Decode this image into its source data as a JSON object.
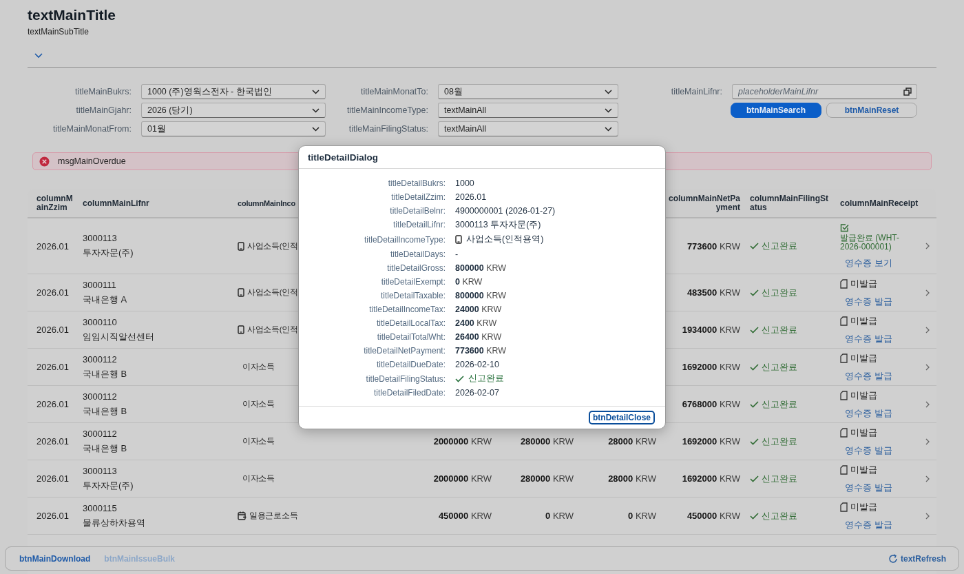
{
  "header": {
    "title": "textMainTitle",
    "subtitle": "textMainSubTitle",
    "expanded": false
  },
  "filter_columns": [
    [
      {
        "kind": "select",
        "label": "titleMainBukrs:",
        "value": "1000 (주)영웍스전자 - 한국법인"
      },
      {
        "kind": "select",
        "label": "titleMainGjahr:",
        "value": "2026 (당기)"
      },
      {
        "kind": "select",
        "label": "titleMainMonatFrom:",
        "value": "01월"
      }
    ],
    [
      {
        "kind": "select",
        "label": "titleMainMonatTo:",
        "value": "08월"
      },
      {
        "kind": "select",
        "label": "titleMainIncomeType:",
        "value": "textMainAll"
      },
      {
        "kind": "select",
        "label": "titleMainFilingStatus:",
        "value": "textMainAll"
      }
    ],
    [
      {
        "kind": "input",
        "label": "titleMainLifnr:",
        "placeholder": "placeholderMainLifnr"
      }
    ]
  ],
  "filter_buttons": [
    {
      "label": "btnMainSearch",
      "kind": "primary"
    },
    {
      "label": "btnMainReset",
      "kind": "secondary"
    }
  ],
  "message": {
    "text": "msgMainOverdue"
  },
  "table": {
    "columns": {
      "zzim": "columnMainZzim",
      "lifnr": "columnMainLifnr",
      "income_type": "columnMainInco",
      "net_payment": "columnMainNetPayment",
      "filing_status": "columnMainFilingStatus",
      "receipt": "columnMainReceipt"
    },
    "rows": [
      {
        "zzim": "2026.01",
        "lifnr": "3000113",
        "name": "투자자문(주)",
        "income": {
          "kind": "business",
          "text": "사업소득(인적"
        },
        "net": {
          "value": "773600",
          "unit": "KRW"
        },
        "filing": {
          "text": "신고완료"
        },
        "receipt": {
          "issued": true,
          "text": "발급완료 (WHT-2026-000001)",
          "link": "영수증 보기"
        }
      },
      {
        "zzim": "2026.01",
        "lifnr": "3000111",
        "name": "국내은행 A",
        "income": {
          "kind": "business",
          "text": "사업소득(인적"
        },
        "net": {
          "value": "483500",
          "unit": "KRW"
        },
        "filing": {
          "text": "신고완료"
        },
        "receipt": {
          "issued": false,
          "text": "미발급",
          "link": "영수증 발급"
        }
      },
      {
        "zzim": "2026.01",
        "lifnr": "3000110",
        "name": "임임시직알선센터",
        "income": {
          "kind": "business",
          "text": "사업소득(인적"
        },
        "net": {
          "value": "1934000",
          "unit": "KRW"
        },
        "filing": {
          "text": "신고완료"
        },
        "receipt": {
          "issued": false,
          "text": "미발급",
          "link": "영수증 발급"
        }
      },
      {
        "zzim": "2026.01",
        "lifnr": "3000112",
        "name": "국내은행 B",
        "income": {
          "kind": "interest",
          "text": "이자소득"
        },
        "net": {
          "value": "1692000",
          "unit": "KRW"
        },
        "filing": {
          "text": "신고완료"
        },
        "receipt": {
          "issued": false,
          "text": "미발급",
          "link": "영수증 발급"
        }
      },
      {
        "zzim": "2026.01",
        "lifnr": "3000112",
        "name": "국내은행 B",
        "income": {
          "kind": "interest",
          "text": "이자소득"
        },
        "net": {
          "value": "6768000",
          "unit": "KRW"
        },
        "filing": {
          "text": "신고완료"
        },
        "receipt": {
          "issued": false,
          "text": "미발급",
          "link": "영수증 발급"
        }
      },
      {
        "zzim": "2026.01",
        "lifnr": "3000112",
        "name": "국내은행 B",
        "income": {
          "kind": "interest",
          "text": "이자소득"
        },
        "amounts": [
          {
            "value": "2000000",
            "unit": "KRW"
          },
          {
            "value": "280000",
            "unit": "KRW"
          },
          {
            "value": "28000",
            "unit": "KRW"
          }
        ],
        "net": {
          "value": "1692000",
          "unit": "KRW"
        },
        "filing": {
          "text": "신고완료"
        },
        "receipt": {
          "issued": false,
          "text": "미발급",
          "link": "영수증 발급"
        }
      },
      {
        "zzim": "2026.01",
        "lifnr": "3000113",
        "name": "투자자문(주)",
        "income": {
          "kind": "interest",
          "text": "이자소득"
        },
        "amounts": [
          {
            "value": "2000000",
            "unit": "KRW"
          },
          {
            "value": "280000",
            "unit": "KRW"
          },
          {
            "value": "28000",
            "unit": "KRW"
          }
        ],
        "net": {
          "value": "1692000",
          "unit": "KRW"
        },
        "filing": {
          "text": "신고완료"
        },
        "receipt": {
          "issued": false,
          "text": "미발급",
          "link": "영수증 발급"
        }
      },
      {
        "zzim": "2026.01",
        "lifnr": "3000115",
        "name": "물류상하차용역",
        "income": {
          "kind": "daily",
          "text": "일용근로소득"
        },
        "amounts": [
          {
            "value": "450000",
            "unit": "KRW"
          },
          {
            "value": "0",
            "unit": "KRW"
          },
          {
            "value": "0",
            "unit": "KRW"
          }
        ],
        "net": {
          "value": "450000",
          "unit": "KRW"
        },
        "filing": {
          "text": "신고완료"
        },
        "receipt": {
          "issued": false,
          "text": "미발급",
          "link": "영수증 발급"
        }
      }
    ]
  },
  "dialog": {
    "title": "titleDetailDialog",
    "fields": [
      {
        "kind": "text",
        "label": "titleDetailBukrs:",
        "value": "1000"
      },
      {
        "kind": "text",
        "label": "titleDetailZzim:",
        "value": "2026.01"
      },
      {
        "kind": "text",
        "label": "titleDetailBelnr:",
        "value": "4900000001 (2026-01-27)"
      },
      {
        "kind": "text",
        "label": "titleDetailLifnr:",
        "value": "3000113 투자자문(주)"
      },
      {
        "kind": "income",
        "label": "titleDetailIncomeType:",
        "value": "사업소득(인적용역)"
      },
      {
        "kind": "text",
        "label": "titleDetailDays:",
        "value": "-"
      },
      {
        "kind": "amount",
        "label": "titleDetailGross:",
        "value": "800000",
        "unit": "KRW"
      },
      {
        "kind": "amount",
        "label": "titleDetailExempt:",
        "value": "0",
        "unit": "KRW"
      },
      {
        "kind": "amount",
        "label": "titleDetailTaxable:",
        "value": "800000",
        "unit": "KRW"
      },
      {
        "kind": "amount",
        "label": "titleDetailIncomeTax:",
        "value": "24000",
        "unit": "KRW"
      },
      {
        "kind": "amount",
        "label": "titleDetailLocalTax:",
        "value": "2400",
        "unit": "KRW"
      },
      {
        "kind": "amount",
        "label": "titleDetailTotalWht:",
        "value": "26400",
        "unit": "KRW"
      },
      {
        "kind": "amount",
        "label": "titleDetailNetPayment:",
        "value": "773600",
        "unit": "KRW"
      },
      {
        "kind": "text",
        "label": "titleDetailDueDate:",
        "value": "2026-02-10"
      },
      {
        "kind": "status",
        "label": "titleDetailFilingStatus:",
        "value": "신고완료"
      },
      {
        "kind": "text",
        "label": "titleDetailFiledDate:",
        "value": "2026-02-07"
      }
    ],
    "close_button": "btnDetailClose"
  },
  "footer": {
    "buttons": [
      {
        "label": "btnMainDownload",
        "disabled": false
      },
      {
        "label": "btnMainIssueBulk",
        "disabled": true
      }
    ],
    "refresh": "textRefresh"
  }
}
